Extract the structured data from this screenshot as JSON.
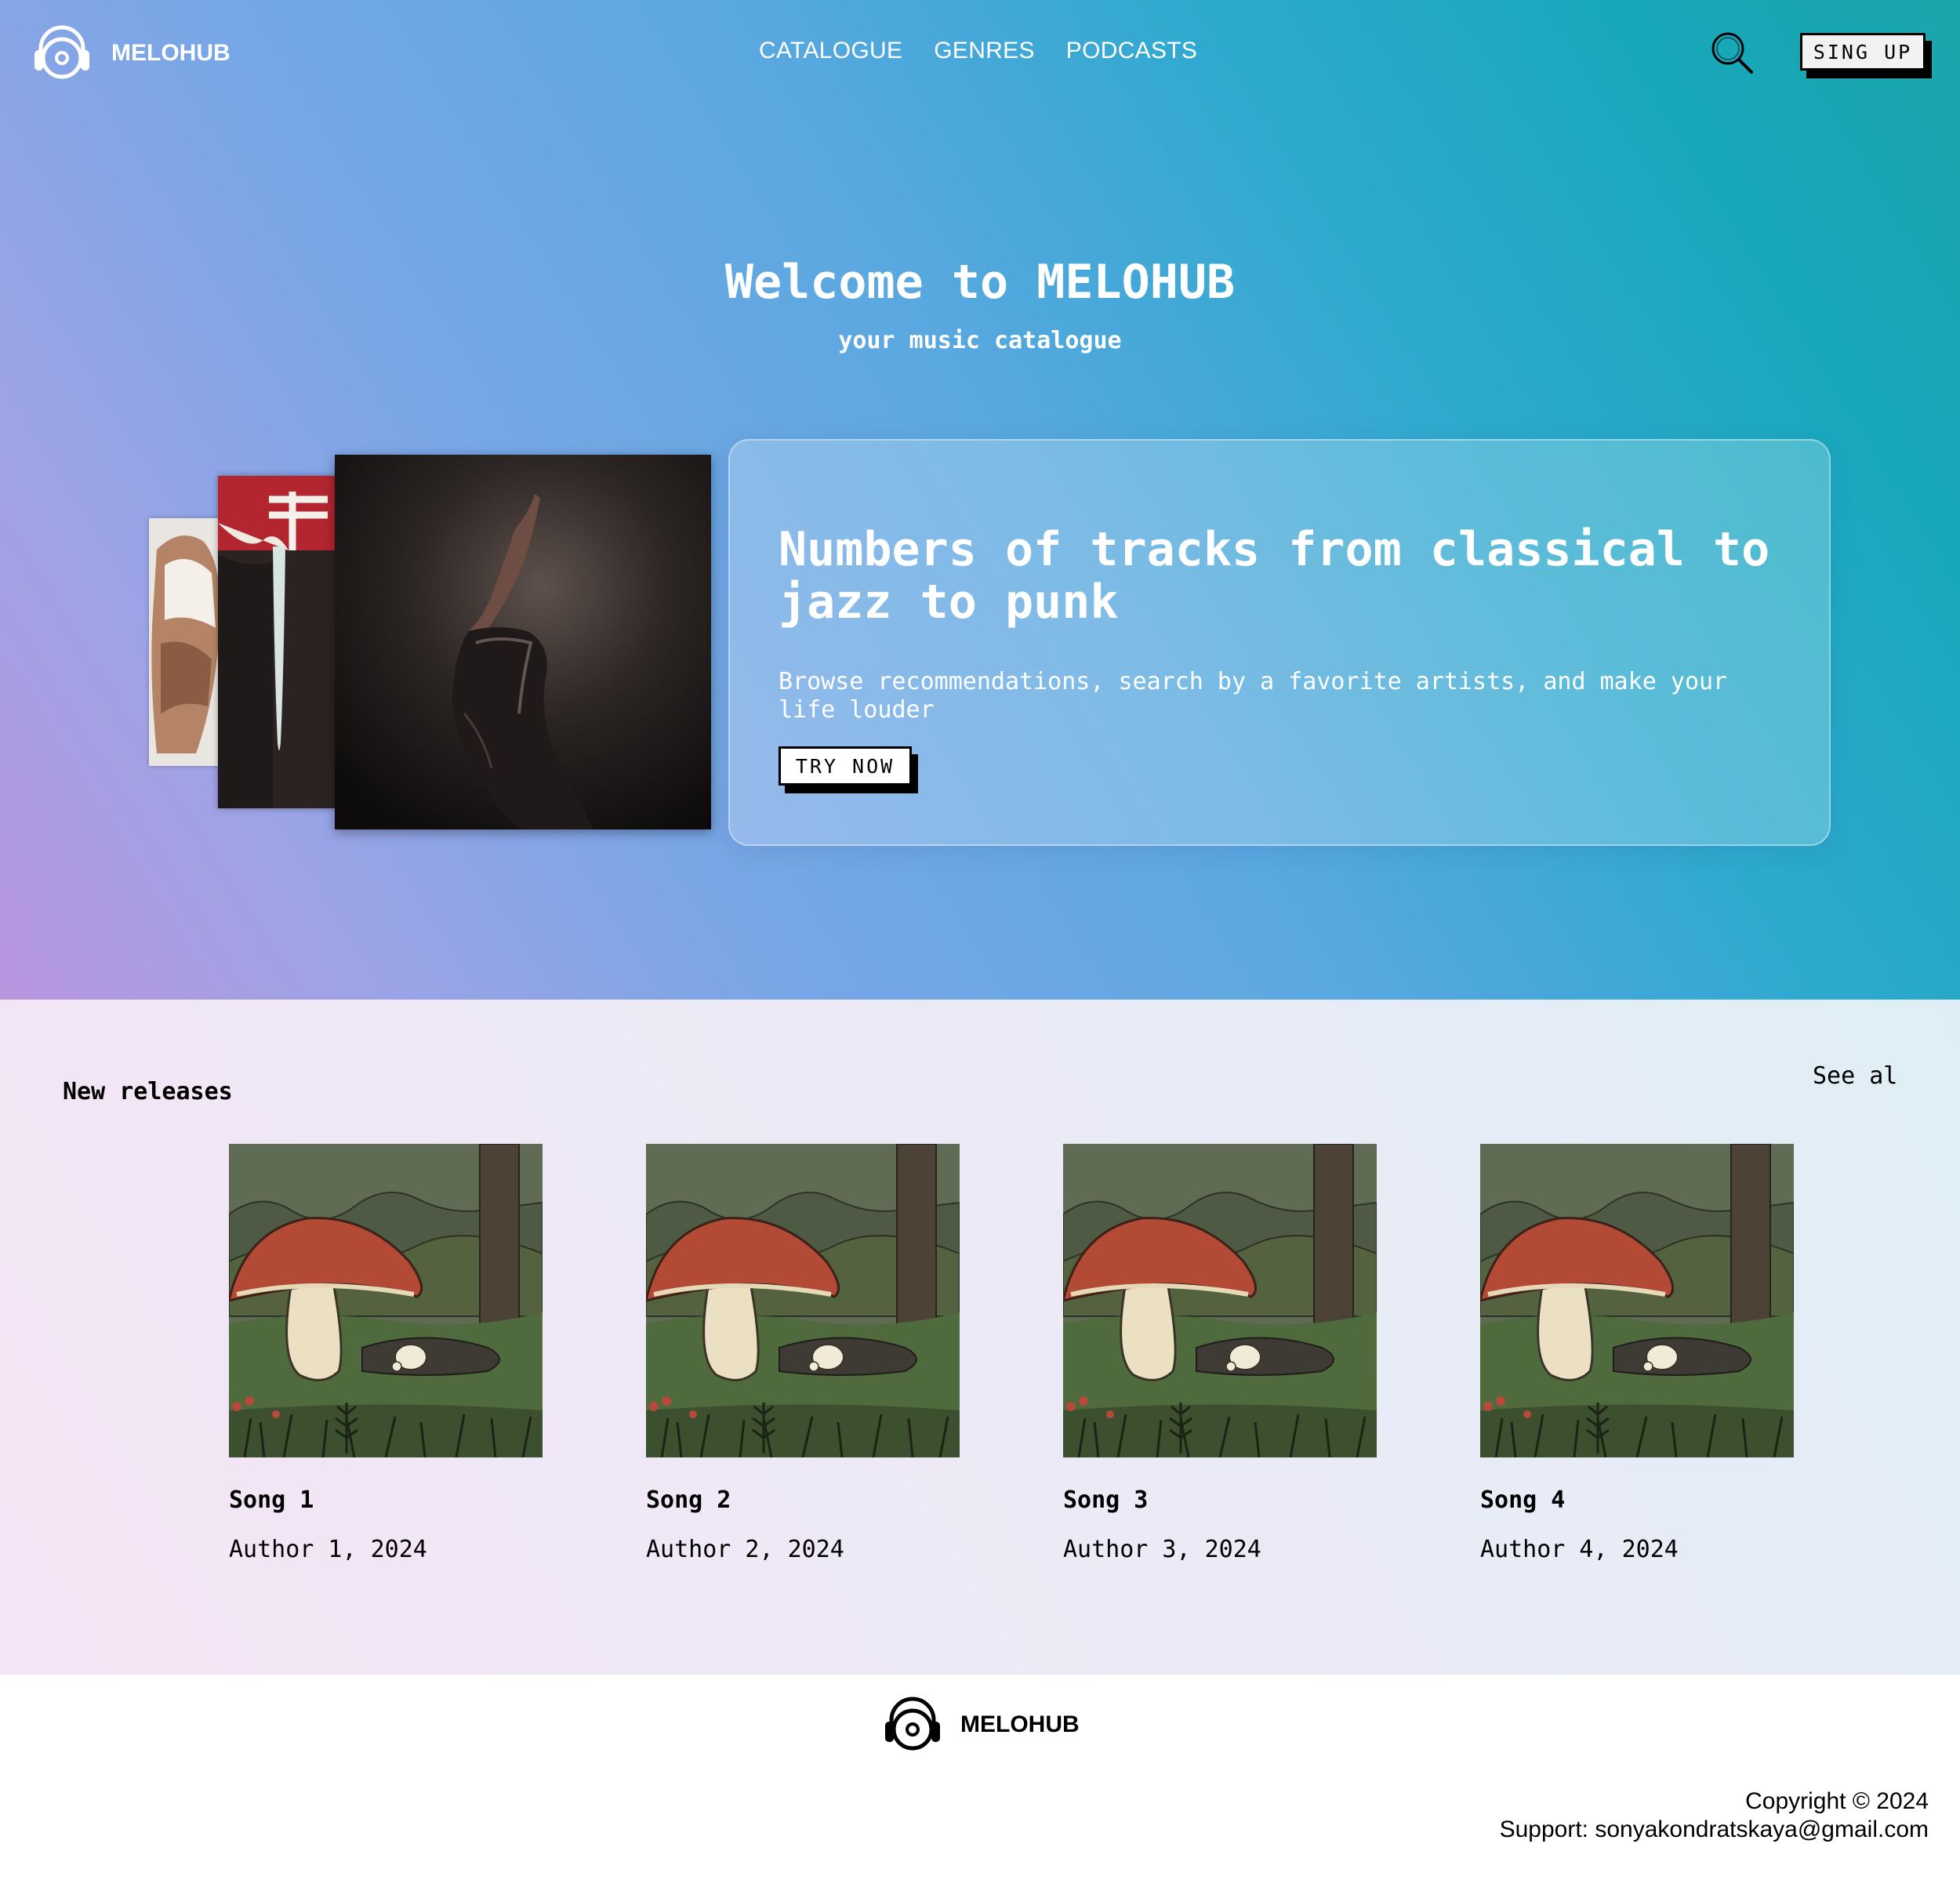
{
  "brand": {
    "name": "MELOHUB",
    "logo_icon": "headphones-record-icon"
  },
  "nav": {
    "items": [
      "CATALOGUE",
      "GENRES",
      "PODCASTS"
    ]
  },
  "header": {
    "search_icon": "search-icon",
    "signup_label": "SING UP"
  },
  "hero": {
    "title": "Welcome to MELOHUB",
    "subtitle": "your music catalogue",
    "promo_title": "Numbers of tracks from classical to jazz to punk",
    "promo_text": "Browse recommendations, search by a favorite artists, and make your life louder",
    "cta_label": "TRY NOW"
  },
  "releases": {
    "title": "New releases",
    "see_all": "See al",
    "items": [
      {
        "title": "Song 1",
        "meta": "Author 1, 2024"
      },
      {
        "title": "Song 2",
        "meta": "Author 2, 2024"
      },
      {
        "title": "Song 3",
        "meta": "Author 3, 2024"
      },
      {
        "title": "Song 4",
        "meta": "Author 4, 2024"
      }
    ]
  },
  "footer": {
    "brand": "MELOHUB",
    "copyright": "Copyright © 2024",
    "support": "Support: sonyakondratskaya@gmail.com"
  }
}
